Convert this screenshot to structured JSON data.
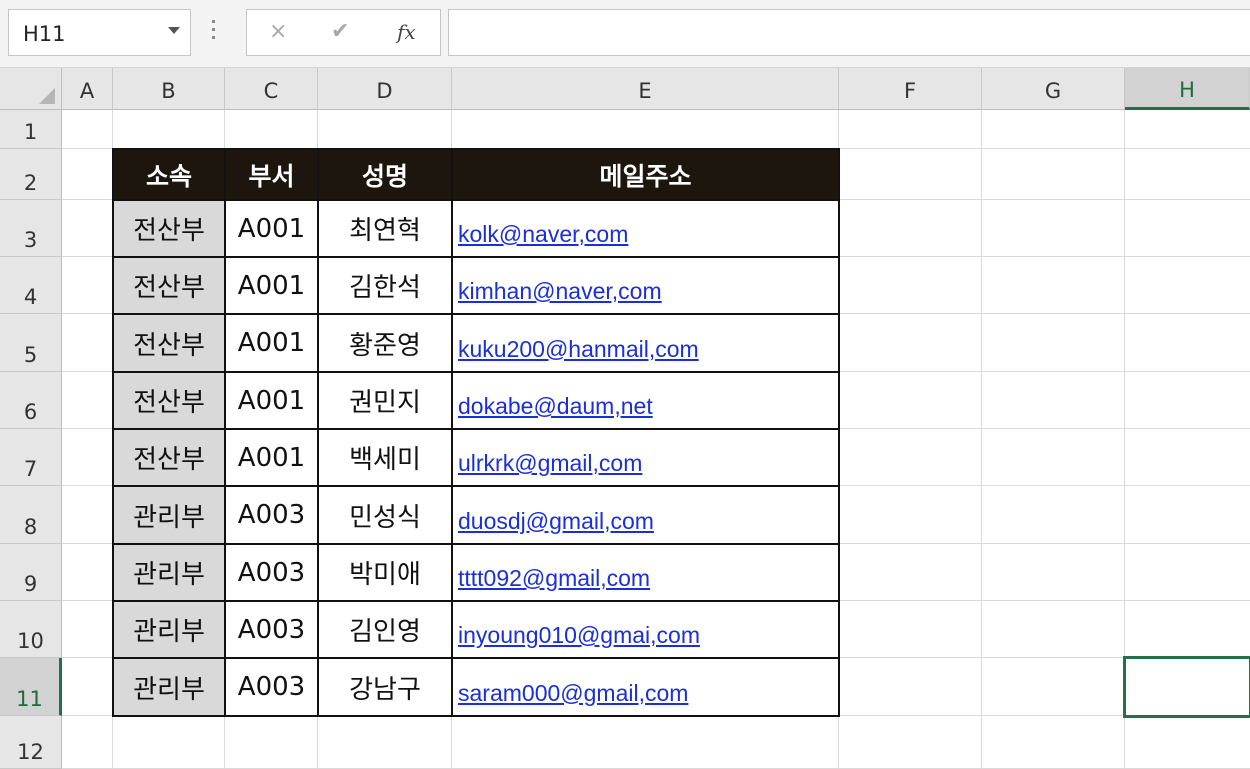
{
  "name_box": {
    "value": "H11"
  },
  "formula_bar": {
    "cancel_icon": "×",
    "enter_icon": "✔",
    "fx_label": "fx",
    "content": ""
  },
  "columns": [
    "A",
    "B",
    "C",
    "D",
    "E",
    "F",
    "G",
    "H"
  ],
  "selected_column": "H",
  "rows": [
    "1",
    "2",
    "3",
    "4",
    "5",
    "6",
    "7",
    "8",
    "9",
    "10",
    "11",
    "12"
  ],
  "selected_row": "11",
  "selected_cell": "H11",
  "table": {
    "headers": [
      "소속",
      "부서",
      "성명",
      "메일주소"
    ],
    "rows": [
      [
        "전산부",
        "A001",
        "최연혁",
        "kolk@naver,com"
      ],
      [
        "전산부",
        "A001",
        "김한석",
        "kimhan@naver,com"
      ],
      [
        "전산부",
        "A001",
        "황준영",
        "kuku200@hanmail,com"
      ],
      [
        "전산부",
        "A001",
        "권민지",
        "dokabe@daum,net"
      ],
      [
        "전산부",
        "A001",
        "백세미",
        "ulrkrk@gmail,com"
      ],
      [
        "관리부",
        "A003",
        "민성식",
        "duosdj@gmail,com"
      ],
      [
        "관리부",
        "A003",
        "박미애",
        "tttt092@gmail,com"
      ],
      [
        "관리부",
        "A003",
        "김인영",
        "inyoung010@gmai,com"
      ],
      [
        "관리부",
        "A003",
        "강남구",
        "saram000@gmail,com"
      ]
    ]
  },
  "colors": {
    "header_bg": "#1c160f",
    "dept_bg": "#d9d9d9",
    "link": "#1a2fd8",
    "selection": "#217346"
  }
}
